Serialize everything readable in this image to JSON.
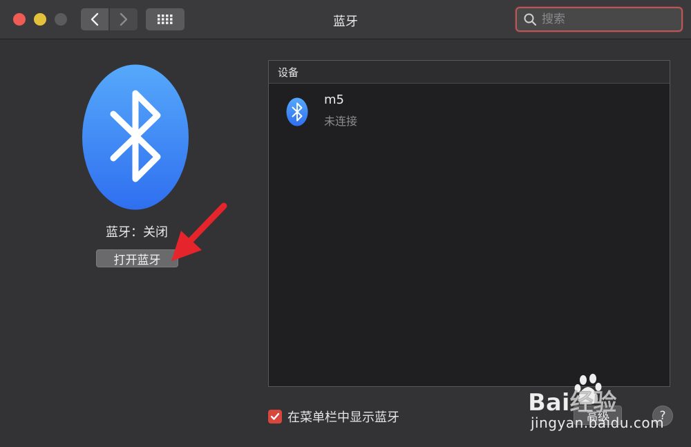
{
  "window": {
    "title": "蓝牙",
    "traffic_lights": {
      "close": "#ee5c55",
      "minimize": "#e4c13a",
      "zoom": "#5b5b5d"
    }
  },
  "toolbar": {
    "back_icon": "chevron-left-icon",
    "forward_icon": "chevron-right-icon",
    "show_all_icon": "grid-icon"
  },
  "search": {
    "placeholder": "搜索",
    "value": ""
  },
  "bluetooth": {
    "status": "蓝牙：关闭",
    "toggle_label": "打开蓝牙",
    "logo_color": "#3a86f5"
  },
  "devices": {
    "header": "设备",
    "items": [
      {
        "name": "m5",
        "status": "未连接",
        "icon": "bluetooth-icon"
      }
    ]
  },
  "menu_bar_option": {
    "label": "在菜单栏中显示蓝牙",
    "checked": true
  },
  "advanced_label": "高级",
  "help_label": "?",
  "watermark": {
    "brand": "Bai经验",
    "url": "jingyan.baidu.com"
  },
  "annotation_color": "#e5242b"
}
